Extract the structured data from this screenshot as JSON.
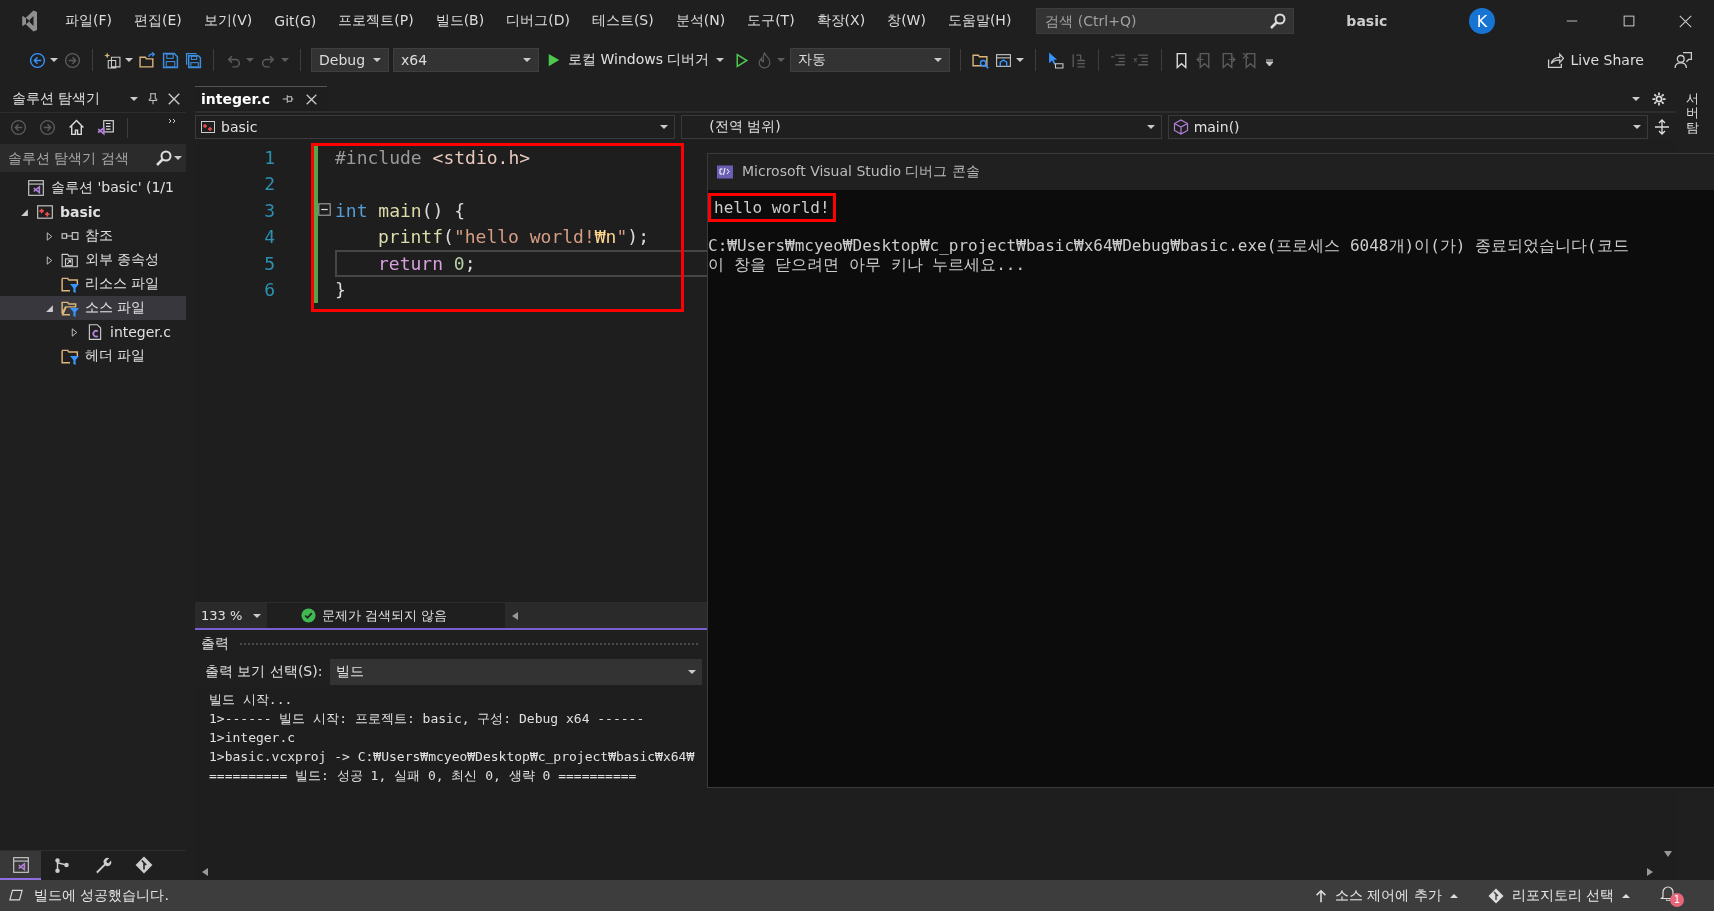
{
  "title_bar": {
    "menu": [
      "파일(F)",
      "편집(E)",
      "보기(V)",
      "Git(G)",
      "프로젝트(P)",
      "빌드(B)",
      "디버그(D)",
      "테스트(S)",
      "분석(N)",
      "도구(T)",
      "확장(X)",
      "창(W)",
      "도움말(H)"
    ],
    "search": {
      "placeholder": "검색 (Ctrl+Q)"
    },
    "solution_name": "basic",
    "account": "K"
  },
  "toolbar": {
    "items": [
      {
        "kind": "back",
        "disabled": false,
        "menu": true
      },
      {
        "kind": "forward",
        "disabled": true
      },
      {
        "kind": "separator"
      },
      {
        "kind": "new-item",
        "disabled": false,
        "menu": true
      },
      {
        "kind": "open",
        "disabled": false
      },
      {
        "kind": "save",
        "disabled": false
      },
      {
        "kind": "save-all",
        "disabled": false
      },
      {
        "kind": "separator"
      },
      {
        "kind": "undo",
        "disabled": true,
        "menu": true
      },
      {
        "kind": "redo",
        "disabled": true,
        "menu": true
      },
      {
        "kind": "separator"
      },
      {
        "kind": "dropdown",
        "value": "Debug"
      },
      {
        "kind": "dropdown",
        "value": "x64"
      },
      {
        "kind": "run",
        "label": "로컬 Windows 디버거",
        "menu": true
      },
      {
        "kind": "start-without-debugging",
        "disabled": false
      },
      {
        "kind": "hot-reload",
        "disabled": true,
        "menu": true
      },
      {
        "kind": "dropdown",
        "value": "자동"
      },
      {
        "kind": "separator"
      },
      {
        "kind": "folder-search",
        "disabled": false
      },
      {
        "kind": "window",
        "disabled": false,
        "menu": true
      },
      {
        "kind": "separator"
      },
      {
        "kind": "pointer",
        "disabled": false
      },
      {
        "kind": "step",
        "disabled": true
      },
      {
        "kind": "separator"
      },
      {
        "kind": "comment",
        "disabled": true
      },
      {
        "kind": "uncomment",
        "disabled": true
      },
      {
        "kind": "separator"
      },
      {
        "kind": "bookmark",
        "disabled": false
      },
      {
        "kind": "prev-bookmark",
        "disabled": true
      },
      {
        "kind": "next-bookmark",
        "disabled": true
      },
      {
        "kind": "clear-bookmarks",
        "disabled": true
      },
      {
        "kind": "overflow"
      }
    ],
    "live_share": "Live Share"
  },
  "solution_explorer": {
    "title": "솔루션 탐색기",
    "search": {
      "placeholder": "솔루션 탐색기 검색"
    },
    "tree": [
      {
        "label": "솔루션 'basic' (1/1",
        "kind": "solution",
        "selected": false,
        "children": [
          {
            "label": "basic",
            "kind": "project",
            "expanded": true,
            "selected": false,
            "children": [
              {
                "label": "참조",
                "kind": "references",
                "expanded": false,
                "selected": false
              },
              {
                "label": "외부 종속성",
                "kind": "external",
                "expanded": false,
                "selected": false
              },
              {
                "label": "리소스 파일",
                "kind": "filter",
                "selected": false
              },
              {
                "label": "소스 파일",
                "kind": "filter-open",
                "expanded": true,
                "selected": true,
                "children": [
                  {
                    "label": "integer.c",
                    "kind": "c-file",
                    "expanded": false,
                    "selected": false
                  }
                ]
              },
              {
                "label": "헤더 파일",
                "kind": "filter",
                "selected": false
              }
            ]
          }
        ]
      }
    ],
    "bottom_tabs": [
      {
        "kind": "solution-explorer",
        "selected": true
      },
      {
        "kind": "git-changes",
        "selected": false
      },
      {
        "kind": "properties",
        "selected": false
      },
      {
        "kind": "git-repository",
        "selected": false
      }
    ]
  },
  "editor": {
    "tabs": [
      {
        "label": "integer.c",
        "selected": true
      }
    ],
    "navigation": [
      {
        "label": "basic",
        "kind": "project"
      },
      {
        "label": "(전역 범위)",
        "kind": "scope"
      },
      {
        "label": "main()",
        "kind": "function"
      }
    ],
    "lines": [
      {
        "number": "1",
        "current": false,
        "changed": true,
        "tokens": [
          {
            "kind": "preprocessor",
            "text": "#include"
          },
          {
            "kind": "include",
            "text": " <stdio.h>"
          }
        ]
      },
      {
        "number": "2",
        "current": false,
        "changed": true
      },
      {
        "number": "3",
        "current": false,
        "changed": true,
        "collapsible": true,
        "tokens": [
          {
            "kind": "keyword",
            "text": "int"
          },
          {
            "kind": "function",
            "text": " main"
          },
          {
            "kind": "punctuation",
            "text": "() {"
          }
        ],
        "children": [
          {
            "number": "4",
            "current": false,
            "changed": true,
            "tokens": [
              {
                "kind": "function",
                "text": "printf"
              },
              {
                "kind": "punctuation",
                "text": "("
              },
              {
                "kind": "string",
                "text": "\"hello world!"
              },
              {
                "kind": "escape",
                "text": "₩n"
              },
              {
                "kind": "string",
                "text": "\""
              },
              {
                "kind": "punctuation",
                "text": ");"
              }
            ]
          },
          {
            "number": "5",
            "current": true,
            "changed": true,
            "tokens": [
              {
                "kind": "control",
                "text": "return"
              },
              {
                "kind": "number",
                "text": " 0"
              },
              {
                "kind": "punctuation",
                "text": ";"
              }
            ]
          }
        ]
      },
      {
        "number": "6",
        "current": false,
        "changed": true,
        "tokens": [
          {
            "kind": "punctuation",
            "text": "}"
          }
        ]
      }
    ],
    "zoom": "133 %",
    "issues": "문제가 검색되지 않음"
  },
  "output": {
    "title": "출력",
    "source_label": "출력 보기 선택(S):",
    "source": "빌드",
    "lines": [
      "빌드 시작...",
      "1>------ 빌드 시작: 프로젝트: basic, 구성: Debug x64 ------",
      "1>integer.c",
      "1>basic.vcxproj -> C:₩Users₩mcyeo₩Desktop₩c_project₩basic₩x64₩",
      "========== 빌드: 성공 1, 실패 0, 최신 0, 생략 0 =========="
    ]
  },
  "console": {
    "title": "Microsoft Visual Studio 디버그 콘솔",
    "output_line": "hello world!",
    "messages": [
      "C:₩Users₩mcyeo₩Desktop₩c_project₩basic₩x64₩Debug₩basic.exe(프로세스 6048개)이(가) 종료되었습니다(코드",
      "이 창을 닫으려면 아무 키나 누르세요..."
    ]
  },
  "side_tab": "서버 탐",
  "status_bar": {
    "message": "빌드에 성공했습니다.",
    "source_control": "소스 제어에 추가",
    "repository": "리포지토리 선택",
    "notifications": "1"
  }
}
